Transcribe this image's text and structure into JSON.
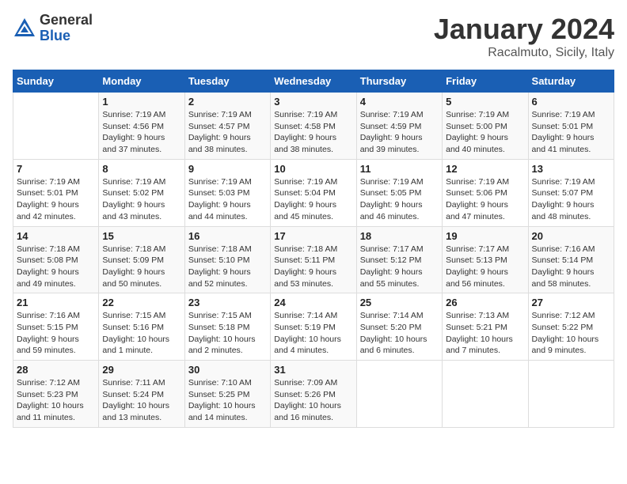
{
  "header": {
    "logo_general": "General",
    "logo_blue": "Blue",
    "month_year": "January 2024",
    "location": "Racalmuto, Sicily, Italy"
  },
  "weekdays": [
    "Sunday",
    "Monday",
    "Tuesday",
    "Wednesday",
    "Thursday",
    "Friday",
    "Saturday"
  ],
  "weeks": [
    {
      "days": [
        {
          "num": "",
          "info": ""
        },
        {
          "num": "1",
          "info": "Sunrise: 7:19 AM\nSunset: 4:56 PM\nDaylight: 9 hours\nand 37 minutes."
        },
        {
          "num": "2",
          "info": "Sunrise: 7:19 AM\nSunset: 4:57 PM\nDaylight: 9 hours\nand 38 minutes."
        },
        {
          "num": "3",
          "info": "Sunrise: 7:19 AM\nSunset: 4:58 PM\nDaylight: 9 hours\nand 38 minutes."
        },
        {
          "num": "4",
          "info": "Sunrise: 7:19 AM\nSunset: 4:59 PM\nDaylight: 9 hours\nand 39 minutes."
        },
        {
          "num": "5",
          "info": "Sunrise: 7:19 AM\nSunset: 5:00 PM\nDaylight: 9 hours\nand 40 minutes."
        },
        {
          "num": "6",
          "info": "Sunrise: 7:19 AM\nSunset: 5:01 PM\nDaylight: 9 hours\nand 41 minutes."
        }
      ]
    },
    {
      "days": [
        {
          "num": "7",
          "info": "Sunrise: 7:19 AM\nSunset: 5:01 PM\nDaylight: 9 hours\nand 42 minutes."
        },
        {
          "num": "8",
          "info": "Sunrise: 7:19 AM\nSunset: 5:02 PM\nDaylight: 9 hours\nand 43 minutes."
        },
        {
          "num": "9",
          "info": "Sunrise: 7:19 AM\nSunset: 5:03 PM\nDaylight: 9 hours\nand 44 minutes."
        },
        {
          "num": "10",
          "info": "Sunrise: 7:19 AM\nSunset: 5:04 PM\nDaylight: 9 hours\nand 45 minutes."
        },
        {
          "num": "11",
          "info": "Sunrise: 7:19 AM\nSunset: 5:05 PM\nDaylight: 9 hours\nand 46 minutes."
        },
        {
          "num": "12",
          "info": "Sunrise: 7:19 AM\nSunset: 5:06 PM\nDaylight: 9 hours\nand 47 minutes."
        },
        {
          "num": "13",
          "info": "Sunrise: 7:19 AM\nSunset: 5:07 PM\nDaylight: 9 hours\nand 48 minutes."
        }
      ]
    },
    {
      "days": [
        {
          "num": "14",
          "info": "Sunrise: 7:18 AM\nSunset: 5:08 PM\nDaylight: 9 hours\nand 49 minutes."
        },
        {
          "num": "15",
          "info": "Sunrise: 7:18 AM\nSunset: 5:09 PM\nDaylight: 9 hours\nand 50 minutes."
        },
        {
          "num": "16",
          "info": "Sunrise: 7:18 AM\nSunset: 5:10 PM\nDaylight: 9 hours\nand 52 minutes."
        },
        {
          "num": "17",
          "info": "Sunrise: 7:18 AM\nSunset: 5:11 PM\nDaylight: 9 hours\nand 53 minutes."
        },
        {
          "num": "18",
          "info": "Sunrise: 7:17 AM\nSunset: 5:12 PM\nDaylight: 9 hours\nand 55 minutes."
        },
        {
          "num": "19",
          "info": "Sunrise: 7:17 AM\nSunset: 5:13 PM\nDaylight: 9 hours\nand 56 minutes."
        },
        {
          "num": "20",
          "info": "Sunrise: 7:16 AM\nSunset: 5:14 PM\nDaylight: 9 hours\nand 58 minutes."
        }
      ]
    },
    {
      "days": [
        {
          "num": "21",
          "info": "Sunrise: 7:16 AM\nSunset: 5:15 PM\nDaylight: 9 hours\nand 59 minutes."
        },
        {
          "num": "22",
          "info": "Sunrise: 7:15 AM\nSunset: 5:16 PM\nDaylight: 10 hours\nand 1 minute."
        },
        {
          "num": "23",
          "info": "Sunrise: 7:15 AM\nSunset: 5:18 PM\nDaylight: 10 hours\nand 2 minutes."
        },
        {
          "num": "24",
          "info": "Sunrise: 7:14 AM\nSunset: 5:19 PM\nDaylight: 10 hours\nand 4 minutes."
        },
        {
          "num": "25",
          "info": "Sunrise: 7:14 AM\nSunset: 5:20 PM\nDaylight: 10 hours\nand 6 minutes."
        },
        {
          "num": "26",
          "info": "Sunrise: 7:13 AM\nSunset: 5:21 PM\nDaylight: 10 hours\nand 7 minutes."
        },
        {
          "num": "27",
          "info": "Sunrise: 7:12 AM\nSunset: 5:22 PM\nDaylight: 10 hours\nand 9 minutes."
        }
      ]
    },
    {
      "days": [
        {
          "num": "28",
          "info": "Sunrise: 7:12 AM\nSunset: 5:23 PM\nDaylight: 10 hours\nand 11 minutes."
        },
        {
          "num": "29",
          "info": "Sunrise: 7:11 AM\nSunset: 5:24 PM\nDaylight: 10 hours\nand 13 minutes."
        },
        {
          "num": "30",
          "info": "Sunrise: 7:10 AM\nSunset: 5:25 PM\nDaylight: 10 hours\nand 14 minutes."
        },
        {
          "num": "31",
          "info": "Sunrise: 7:09 AM\nSunset: 5:26 PM\nDaylight: 10 hours\nand 16 minutes."
        },
        {
          "num": "",
          "info": ""
        },
        {
          "num": "",
          "info": ""
        },
        {
          "num": "",
          "info": ""
        }
      ]
    }
  ]
}
